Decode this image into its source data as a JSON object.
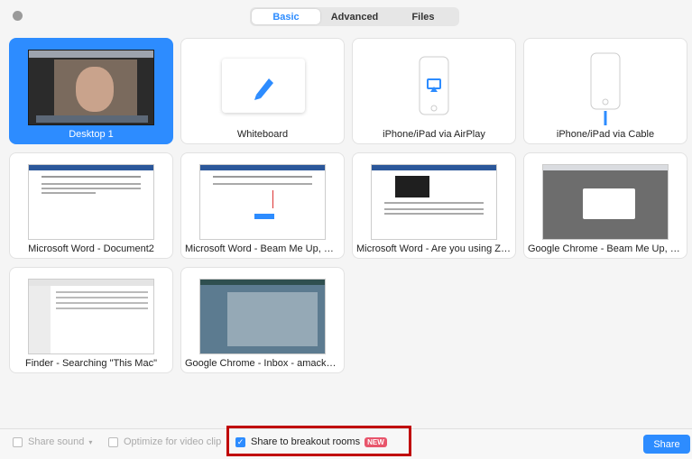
{
  "tabs": [
    {
      "label": "Basic"
    },
    {
      "label": "Advanced"
    },
    {
      "label": "Files"
    }
  ],
  "tiles": [
    {
      "label": "Desktop 1"
    },
    {
      "label": "Whiteboard"
    },
    {
      "label": "iPhone/iPad via AirPlay"
    },
    {
      "label": "iPhone/iPad via Cable"
    },
    {
      "label": "Microsoft Word - Document2"
    },
    {
      "label": "Microsoft Word - Beam Me Up, Sc..."
    },
    {
      "label": "Microsoft Word - Are you using Zo..."
    },
    {
      "label": "Google Chrome - Beam Me Up, Sc..."
    },
    {
      "label": "Finder - Searching \"This Mac\""
    },
    {
      "label": "Google Chrome - Inbox - amacker...."
    }
  ],
  "bottom": {
    "share_sound": "Share sound",
    "share_sound_arrow": "▾",
    "optimize": "Optimize for video clip",
    "breakout": "Share to breakout rooms",
    "new_badge": "NEW",
    "share_button": "Share"
  },
  "colors": {
    "accent": "#2d8cff",
    "highlight": "#c00000",
    "badge": "#e8556b"
  }
}
